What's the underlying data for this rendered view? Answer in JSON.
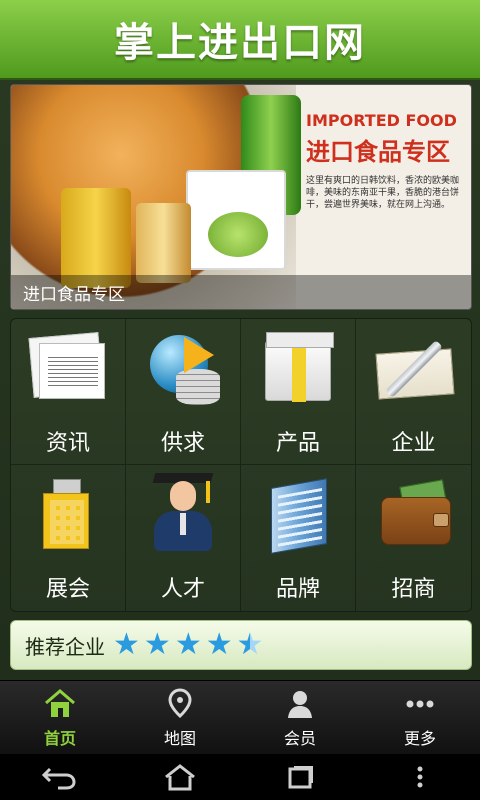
{
  "app": {
    "title": "掌上进出口网"
  },
  "banner": {
    "headline_en": "IMPORTED FOOD",
    "headline_zh": "进口食品专区",
    "desc": "这里有爽口的日韩饮料，香浓的欧美咖啡，美味的东南亚干果，香脆的港台饼干，尝遍世界美味，就在网上沟通。",
    "caption": "进口食品专区"
  },
  "grid": {
    "items": [
      {
        "label": "资讯",
        "icon": "newspaper-icon"
      },
      {
        "label": "供求",
        "icon": "globe-coins-icon"
      },
      {
        "label": "产品",
        "icon": "box-icon"
      },
      {
        "label": "企业",
        "icon": "cheque-pen-icon"
      },
      {
        "label": "展会",
        "icon": "building-icon"
      },
      {
        "label": "人才",
        "icon": "graduate-icon"
      },
      {
        "label": "品牌",
        "icon": "office-building-icon"
      },
      {
        "label": "招商",
        "icon": "wallet-icon"
      }
    ]
  },
  "recommend": {
    "label": "推荐企业",
    "rating": 4.5
  },
  "tabbar": {
    "tabs": [
      {
        "label": "首页",
        "icon": "home-icon",
        "active": true
      },
      {
        "label": "地图",
        "icon": "map-pin-icon",
        "active": false
      },
      {
        "label": "会员",
        "icon": "user-icon",
        "active": false
      },
      {
        "label": "更多",
        "icon": "more-icon",
        "active": false
      }
    ]
  },
  "system": {
    "buttons": [
      "back-icon",
      "home-icon",
      "recent-apps-icon",
      "overflow-menu-icon"
    ]
  },
  "colors": {
    "accent": "#8fd23d",
    "star": "#2b9be0"
  }
}
